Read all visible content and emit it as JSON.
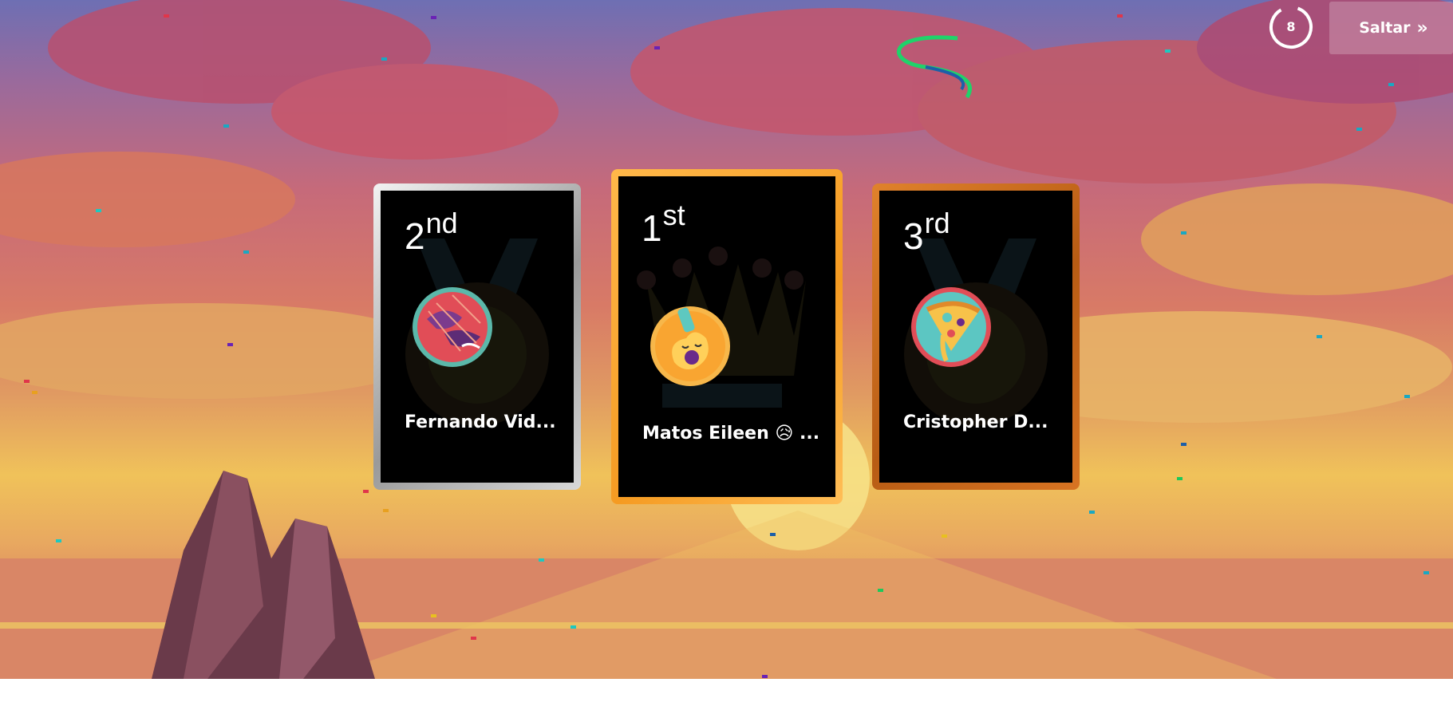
{
  "timer": {
    "value": "8"
  },
  "skip_button": {
    "label": "Saltar",
    "icon": "double-chevron-right-icon"
  },
  "podium": [
    {
      "place": "2",
      "suffix": "nd",
      "name": "Fernando Vid...",
      "avatar_icon": "bats-avatar-icon",
      "frame": "silver"
    },
    {
      "place": "1",
      "suffix": "st",
      "name": "Matos Eileen 😥 ...",
      "avatar_icon": "guitar-avatar-icon",
      "frame": "gold"
    },
    {
      "place": "3",
      "suffix": "rd",
      "name": "Cristopher D...",
      "avatar_icon": "pizza-avatar-icon",
      "frame": "bronze"
    }
  ],
  "colors": {
    "silver": "#c4c4c4",
    "gold": "#f59b22",
    "bronze": "#b85c14",
    "card_bg": "#000000"
  }
}
